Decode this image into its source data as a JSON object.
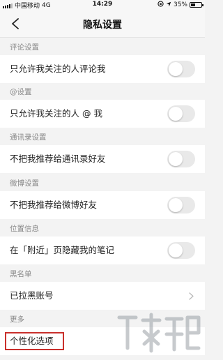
{
  "status_bar": {
    "carrier": "中国移动",
    "network": "4G",
    "time": "14:29",
    "battery": "35%"
  },
  "nav": {
    "title": "隐私设置"
  },
  "sections": [
    {
      "header": "评论设置",
      "row_label": "只允许我关注的人评论我",
      "control": "toggle",
      "toggle_on": false
    },
    {
      "header": "@设置",
      "row_label": "只允许我关注的人 @ 我",
      "control": "toggle",
      "toggle_on": false
    },
    {
      "header": "通讯录设置",
      "row_label": "不把我推荐给通讯录好友",
      "control": "toggle",
      "toggle_on": false
    },
    {
      "header": "微博设置",
      "row_label": "不把我推荐给微博好友",
      "control": "toggle",
      "toggle_on": false
    },
    {
      "header": "位置信息",
      "row_label": "在「附近」页隐藏我的笔记",
      "control": "toggle",
      "toggle_on": false
    },
    {
      "header": "黑名单",
      "row_label": "已拉黑账号",
      "control": "chevron"
    },
    {
      "header": "更多",
      "row_label": "个性化选项",
      "control": "none"
    }
  ],
  "colors": {
    "background": "#f3f3f3",
    "row_background": "#ffffff",
    "section_text": "#888888",
    "toggle_off": "#e9e9e9",
    "highlight": "#c9302c"
  },
  "icons": {
    "back": "chevron-left-icon",
    "row_arrow": "chevron-right-icon",
    "watermark": "watermark-logo"
  }
}
